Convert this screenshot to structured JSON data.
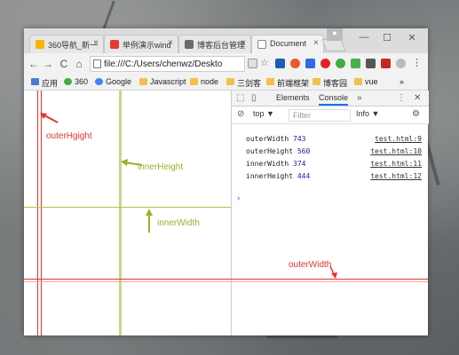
{
  "tabs": [
    {
      "label": "360导航_新一",
      "color": "#f7b500"
    },
    {
      "label": "举例演示wind",
      "color": "#e63b2e"
    },
    {
      "label": "博客后台管理",
      "color": "#6b6b6b"
    },
    {
      "label": "Document",
      "color": "#ffffff"
    }
  ],
  "tab_close": "×",
  "window_controls": {
    "minimize": "—",
    "maximize": "☐",
    "close": "✕"
  },
  "nav": {
    "back": "←",
    "forward": "→",
    "reload": "C",
    "home": "⌂"
  },
  "address": "file:///C:/Users/chenwz/Deskto",
  "bookmarks": [
    {
      "label": "应用",
      "color": "#4a7cd6"
    },
    {
      "label": "360",
      "color": "#3fae3f"
    },
    {
      "label": "Google",
      "color": "#4285f4"
    },
    {
      "label": "Javascript",
      "color": "#f0c14b"
    },
    {
      "label": "node",
      "color": "#f0c14b"
    },
    {
      "label": "三剑客",
      "color": "#f0c14b"
    },
    {
      "label": "前端框架",
      "color": "#f0c14b"
    },
    {
      "label": "博客园",
      "color": "#f0c14b"
    },
    {
      "label": "vue",
      "color": "#f0c14b"
    }
  ],
  "bookmarks_more": "»",
  "devtools": {
    "tabs": [
      "Elements",
      "Console"
    ],
    "active_tab": "Console",
    "more": "»",
    "menu": "⋮",
    "close": "✕",
    "context": "top",
    "filter_placeholder": "Filter",
    "levels": "Info",
    "logs": [
      {
        "key": "outerWidth",
        "value": "743",
        "source": "test.html:9"
      },
      {
        "key": "outerHeight",
        "value": "560",
        "source": "test.html:10"
      },
      {
        "key": "innerWidth",
        "value": "374",
        "source": "test.html:11"
      },
      {
        "key": "innerHeight",
        "value": "444",
        "source": "test.html:12"
      }
    ],
    "prompt": "›"
  },
  "annotations": {
    "outer_height": "outerHgight",
    "inner_height": "innerHeight",
    "inner_width": "innerWidth",
    "outer_width": "outerWidth"
  },
  "colors": {
    "red": "#e8322e",
    "green": "#8fb62a",
    "blue": "#1a73e8"
  }
}
